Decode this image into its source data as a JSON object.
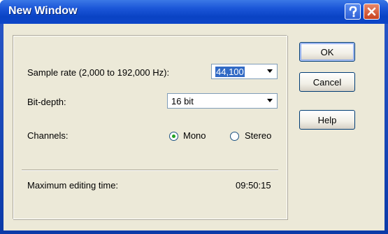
{
  "window": {
    "title": "New Window"
  },
  "titlebar": {
    "help_icon": "question-mark-icon",
    "close_icon": "close-x-icon"
  },
  "form": {
    "sample_rate_label": "Sample rate (2,000 to 192,000 Hz):",
    "sample_rate_value": "44,100",
    "bit_depth_label": "Bit-depth:",
    "bit_depth_value": "16 bit",
    "channels_label": "Channels:",
    "channels_options": [
      {
        "label": "Mono",
        "selected": true
      },
      {
        "label": "Stereo",
        "selected": false
      }
    ],
    "max_time_label": "Maximum editing time:",
    "max_time_value": "09:50:15"
  },
  "buttons": {
    "ok": "OK",
    "cancel": "Cancel",
    "help": "Help"
  }
}
